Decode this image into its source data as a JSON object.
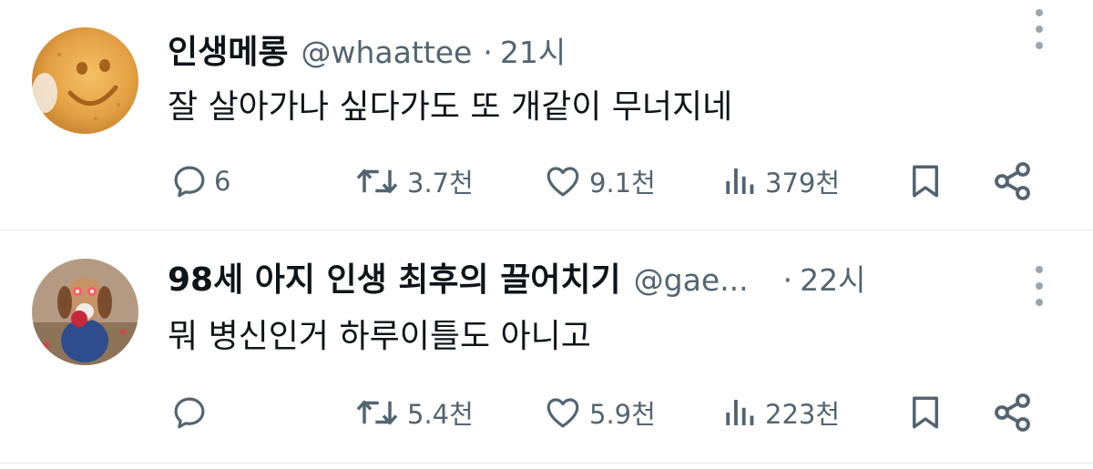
{
  "tweets": [
    {
      "name": "인생메롱",
      "handle": "@whaattee",
      "separator": "·",
      "time": "21시",
      "text": "잘 살아가나 싶다가도 또 개같이 무너지네",
      "avatar_icon": "smiley-cookie-avatar",
      "replies": "6",
      "retweets": "3.7천",
      "likes": "9.1천",
      "views": "379천"
    },
    {
      "name": "98세 아지 인생 최후의 끌어치기",
      "handle": "@gae...",
      "separator": "·",
      "time": "22시",
      "text": "뭐 병신인거 하루이틀도 아니고",
      "avatar_icon": "dog-with-apple-avatar",
      "replies": "",
      "retweets": "5.4천",
      "likes": "5.9천",
      "views": "223천"
    }
  ],
  "colors": {
    "text": "#0f1419",
    "secondary": "#536471",
    "divider": "#e6e9ec",
    "background": "#ffffff"
  }
}
